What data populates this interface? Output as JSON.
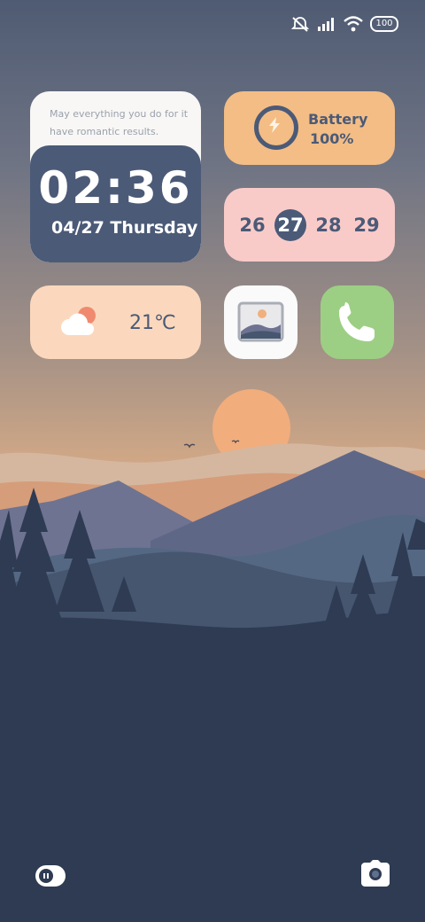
{
  "status_bar": {
    "icons": [
      "mute-icon",
      "signal-icon",
      "wifi-icon"
    ],
    "battery_level": "100"
  },
  "clock_widget": {
    "quote": "May everything you do for it have romantic results.",
    "time": "02:36",
    "date": "04/27 Thursday"
  },
  "battery_widget": {
    "label": "Battery",
    "value": "100%"
  },
  "calendar_widget": {
    "days": [
      "26",
      "27",
      "28",
      "29"
    ],
    "selected": "27"
  },
  "weather_widget": {
    "icon": "partly-cloudy-icon",
    "temperature": "21℃"
  },
  "apps": [
    {
      "name": "gallery",
      "icon": "gallery-icon"
    },
    {
      "name": "phone",
      "icon": "phone-icon"
    }
  ],
  "dock": {
    "left_icon": "toggle-icon",
    "right_icon": "camera-icon"
  },
  "colors": {
    "accent_navy": "#4b5a77",
    "battery_bg": "#f3bd85",
    "calendar_bg": "#f8cbc9",
    "weather_bg": "#fbd8bd",
    "phone_bg": "#9ccf84"
  }
}
